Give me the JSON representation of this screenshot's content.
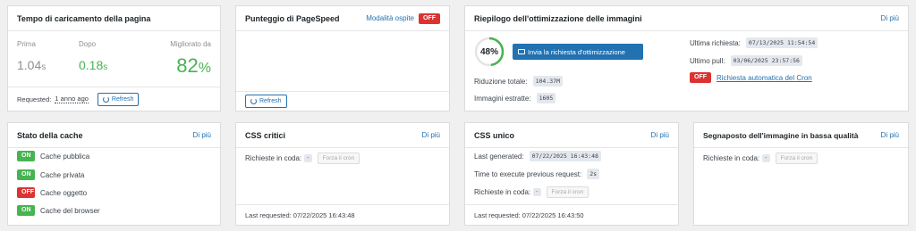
{
  "load_time": {
    "title": "Tempo di caricamento della pagina",
    "before_label": "Prima",
    "after_label": "Dopo",
    "improved_label": "Migliorato da",
    "before_value": "1.04",
    "before_unit": "s",
    "after_value": "0.18",
    "after_unit": "s",
    "improved_value": "82",
    "improved_unit": "%",
    "requested_prefix": "Requested:",
    "requested_when": "1 anno ago",
    "refresh_label": "Refresh"
  },
  "pagespeed": {
    "title": "Punteggio di PageSpeed",
    "guest_mode_label": "Modalità ospite",
    "guest_mode_status": "OFF",
    "refresh_label": "Refresh"
  },
  "image_opt": {
    "title": "Riepilogo dell'ottimizzazione delle immagini",
    "more_label": "Di più",
    "percent": "48%",
    "progress": 48,
    "send_request_label": "Invia la richiesta d'ottimizzazione",
    "reduction_label": "Riduzione totale:",
    "reduction_value": "104.37M",
    "pulled_label": "Immagini estratte:",
    "pulled_value": "1605",
    "last_request_label": "Ultima richiesta:",
    "last_request_value": "07/13/2025 11:54:54",
    "last_pull_label": "Ultimo pull:",
    "last_pull_value": "03/06/2025 23:57:56",
    "auto_request_status": "OFF",
    "auto_request_label": "Richiesta automatica del Cron"
  },
  "cache": {
    "title": "Stato della cache",
    "more_label": "Di più",
    "items": [
      {
        "status": "ON",
        "label": "Cache pubblica"
      },
      {
        "status": "ON",
        "label": "Cache privata"
      },
      {
        "status": "OFF",
        "label": "Cache oggetto"
      },
      {
        "status": "ON",
        "label": "Cache del browser"
      }
    ]
  },
  "critical_css": {
    "title": "CSS critici",
    "more_label": "Di più",
    "queue_label": "Richieste in coda:",
    "queue_value": "-",
    "force_cron_label": "Forza il cron",
    "last_requested": "Last requested: 07/22/2025 16:43:48"
  },
  "unique_css": {
    "title": "CSS unico",
    "more_label": "Di più",
    "last_generated_label": "Last generated:",
    "last_generated_value": "07/22/2025 16:43:48",
    "time_exec_label": "Time to execute previous request:",
    "time_exec_value": "2s",
    "queue_label": "Richieste in coda:",
    "queue_value": "-",
    "force_cron_label": "Forza il cron",
    "last_requested": "Last requested: 07/22/2025 16:43:50"
  },
  "lqip": {
    "title": "Segnaposto dell'immagine in bassa qualità",
    "more_label": "Di più",
    "queue_label": "Richieste in coda:",
    "queue_value": "-",
    "force_cron_label": "Forza il cron"
  },
  "colors": {
    "accent": "#2271b1",
    "success": "#46b450",
    "danger": "#dc3232"
  }
}
